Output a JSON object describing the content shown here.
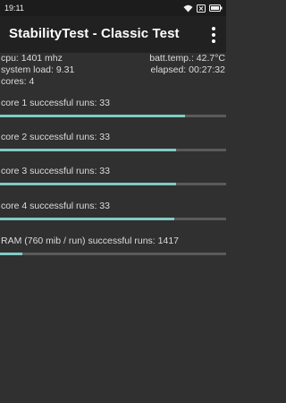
{
  "status_bar": {
    "time": "19:11"
  },
  "app_bar": {
    "title": "StabilityTest - Classic Test"
  },
  "info": {
    "cpu": "cpu: 1401 mhz",
    "batt_temp": "batt.temp.: 42.7°C",
    "system_load": "system load: 9.31",
    "elapsed": "elapsed: 00:27:32",
    "cores": "cores: 4"
  },
  "tests": [
    {
      "label": "core 1 successful runs: 33",
      "progress": 0.82
    },
    {
      "label": "core 2 successful runs: 33",
      "progress": 0.78
    },
    {
      "label": "core 3 successful runs: 33",
      "progress": 0.78
    },
    {
      "label": "core 4 successful runs: 33",
      "progress": 0.77
    },
    {
      "label": "RAM (760 mib / run) successful runs: 1417",
      "progress": 0.1
    }
  ],
  "colors": {
    "accent": "#80cbc4",
    "track": "#5a5a5a",
    "background": "#303030",
    "appbar": "#212121"
  }
}
